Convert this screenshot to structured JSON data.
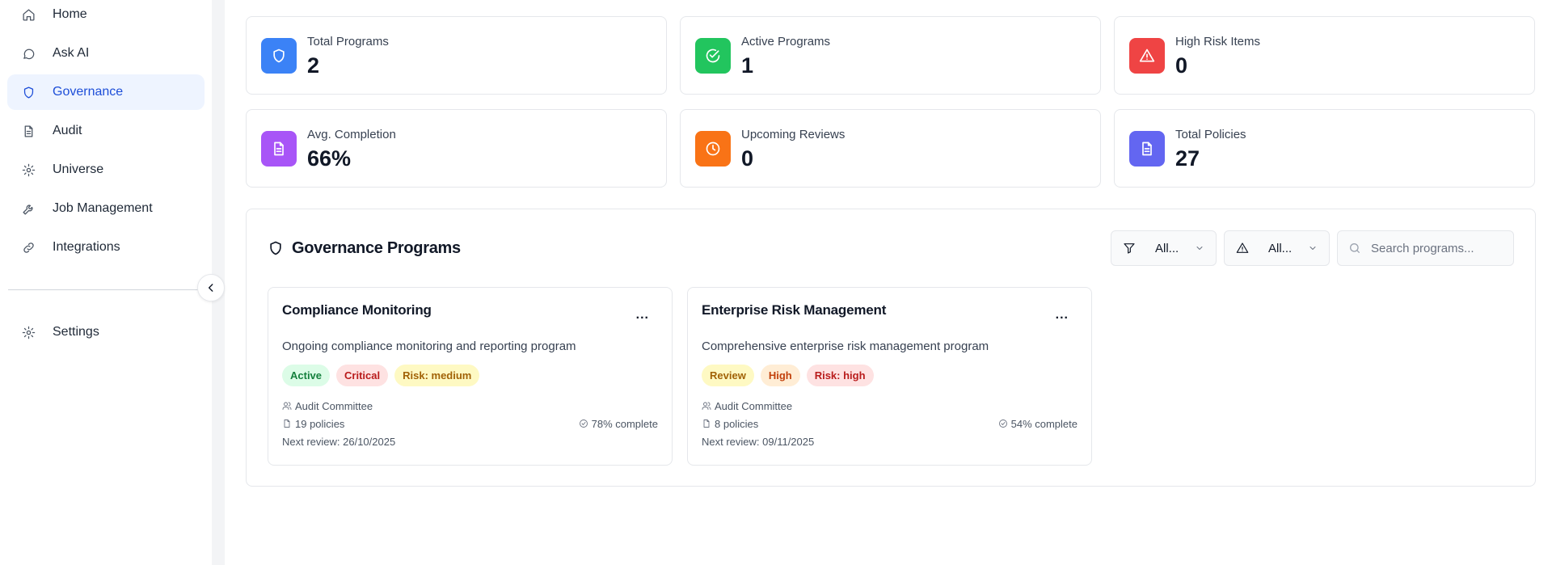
{
  "sidebar": {
    "items": [
      {
        "label": "Home",
        "icon": "home-icon"
      },
      {
        "label": "Ask AI",
        "icon": "chat-icon"
      },
      {
        "label": "Governance",
        "icon": "shield-icon",
        "active": true
      },
      {
        "label": "Audit",
        "icon": "document-icon"
      },
      {
        "label": "Universe",
        "icon": "gear-icon"
      },
      {
        "label": "Job Management",
        "icon": "wrench-icon"
      },
      {
        "label": "Integrations",
        "icon": "link-icon"
      }
    ],
    "settings_label": "Settings"
  },
  "stats": [
    {
      "label": "Total Programs",
      "value": "2",
      "color": "#3b82f6",
      "icon": "shield-icon"
    },
    {
      "label": "Active Programs",
      "value": "1",
      "color": "#22c55e",
      "icon": "check-circle-icon"
    },
    {
      "label": "High Risk Items",
      "value": "0",
      "color": "#ef4444",
      "icon": "warning-icon"
    },
    {
      "label": "Avg. Completion",
      "value": "66%",
      "color": "#a855f7",
      "icon": "document-icon"
    },
    {
      "label": "Upcoming Reviews",
      "value": "0",
      "color": "#f97316",
      "icon": "clock-icon"
    },
    {
      "label": "Total Policies",
      "value": "27",
      "color": "#6366f1",
      "icon": "document-icon"
    }
  ],
  "programs": {
    "title": "Governance Programs",
    "status_filter": "All...",
    "risk_filter": "All...",
    "search_placeholder": "Search programs...",
    "cards": [
      {
        "title": "Compliance Monitoring",
        "menu": "...",
        "description": "Ongoing compliance monitoring and reporting program",
        "badges": [
          {
            "text": "Active",
            "bg": "#dcfce7",
            "fg": "#15803d"
          },
          {
            "text": "Critical",
            "bg": "#fee2e2",
            "fg": "#b91c1c"
          },
          {
            "text": "Risk: medium",
            "bg": "#fef9c3",
            "fg": "#a16207"
          }
        ],
        "owner": "Audit Committee",
        "policies": "19 policies",
        "completion": "78% complete",
        "next_review": "Next review: 26/10/2025"
      },
      {
        "title": "Enterprise Risk Management",
        "menu": "...",
        "description": "Comprehensive enterprise risk management program",
        "badges": [
          {
            "text": "Review",
            "bg": "#fef9c3",
            "fg": "#a16207"
          },
          {
            "text": "High",
            "bg": "#ffedd5",
            "fg": "#c2410c"
          },
          {
            "text": "Risk: high",
            "bg": "#fee2e2",
            "fg": "#b91c1c"
          }
        ],
        "owner": "Audit Committee",
        "policies": "8 policies",
        "completion": "54% complete",
        "next_review": "Next review: 09/11/2025"
      }
    ]
  }
}
